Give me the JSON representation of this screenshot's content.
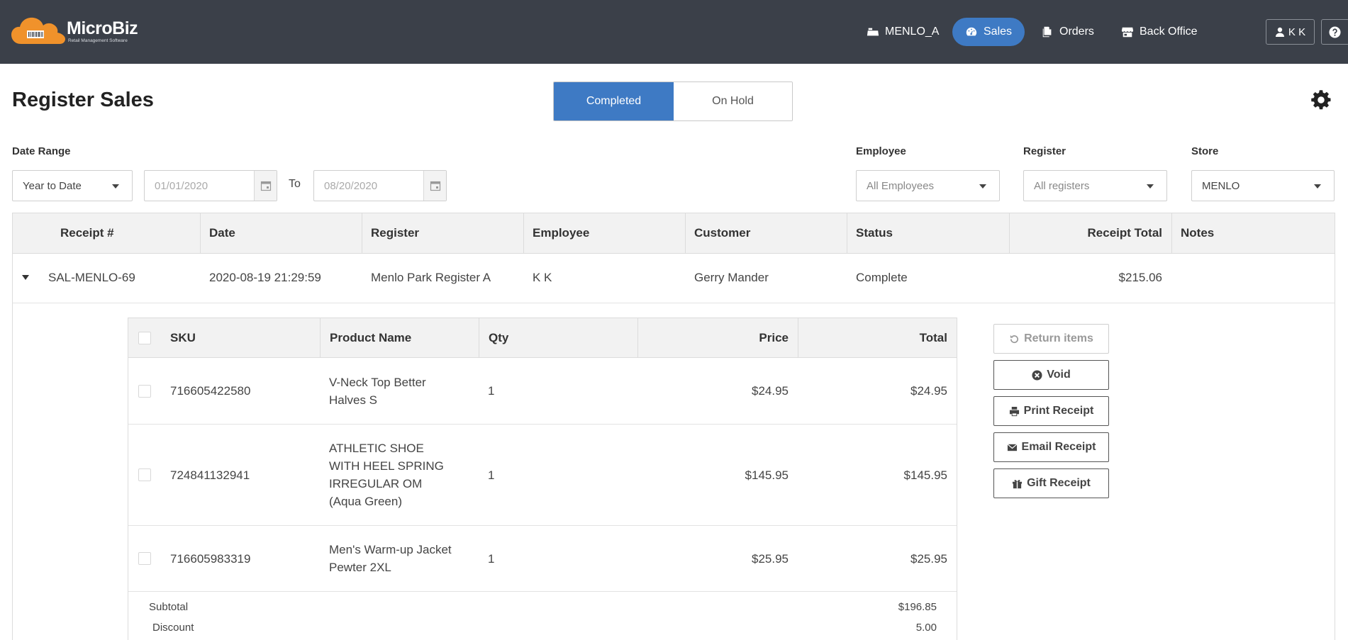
{
  "app": {
    "brand": "MicroBiz",
    "tagline": "Retail Management Software"
  },
  "nav": {
    "register": "MENLO_A",
    "sales": "Sales",
    "orders": "Orders",
    "back_office": "Back Office",
    "user": "K K"
  },
  "page": {
    "title": "Register Sales",
    "tabs": [
      "Completed",
      "On Hold"
    ],
    "active_tab": "Completed"
  },
  "filters": {
    "date_range_label": "Date Range",
    "date_range_value": "Year to Date",
    "date_from_placeholder": "01/01/2020",
    "to_label": "To",
    "date_to_placeholder": "08/20/2020",
    "employee_label": "Employee",
    "employee_value": "All Employees",
    "register_label": "Register",
    "register_value": "All registers",
    "store_label": "Store",
    "store_value": "MENLO"
  },
  "sales_table": {
    "columns": [
      "Receipt #",
      "Date",
      "Register",
      "Employee",
      "Customer",
      "Status",
      "Receipt Total",
      "Notes"
    ],
    "rows": [
      {
        "receipt": "SAL-MENLO-69",
        "date": "2020-08-19 21:29:59",
        "register": "Menlo Park Register A",
        "employee": "K K",
        "customer": "Gerry Mander",
        "status": "Complete",
        "total": "$215.06",
        "notes": ""
      }
    ]
  },
  "line_items": {
    "columns": [
      "SKU",
      "Product Name",
      "Qty",
      "Price",
      "Total"
    ],
    "rows": [
      {
        "sku": "716605422580",
        "name": "V-Neck Top Better Halves S",
        "qty": "1",
        "price": "$24.95",
        "total": "$24.95"
      },
      {
        "sku": "724841132941",
        "name": "ATHLETIC SHOE WITH HEEL SPRING IRREGULAR OM (Aqua Green)",
        "qty": "1",
        "price": "$145.95",
        "total": "$145.95"
      },
      {
        "sku": "716605983319",
        "name": "Men's Warm-up Jacket Pewter 2XL",
        "qty": "1",
        "price": "$25.95",
        "total": "$25.95"
      }
    ],
    "summary": {
      "subtotal_label": "Subtotal",
      "subtotal_value": "$196.85",
      "discount_label": "Discount",
      "discount_value": "5.00"
    }
  },
  "actions": {
    "return_items": "Return items",
    "void": "Void",
    "print_receipt": "Print Receipt",
    "email_receipt": "Email Receipt",
    "gift_receipt": "Gift Receipt"
  },
  "colors": {
    "topbar": "#3b4049",
    "accent": "#3e7ac4",
    "logo_orange": "#f0922b"
  },
  "icons": {
    "register": "cash-register-icon",
    "sales": "dashboard-icon",
    "orders": "copy-icon",
    "back_office": "store-icon",
    "user": "user-icon",
    "help": "question-icon",
    "settings": "gear-icon",
    "calendar": "calendar-icon",
    "return": "undo-icon",
    "void": "times-circle-icon",
    "print": "print-icon",
    "email": "envelope-icon",
    "gift": "gift-icon"
  }
}
